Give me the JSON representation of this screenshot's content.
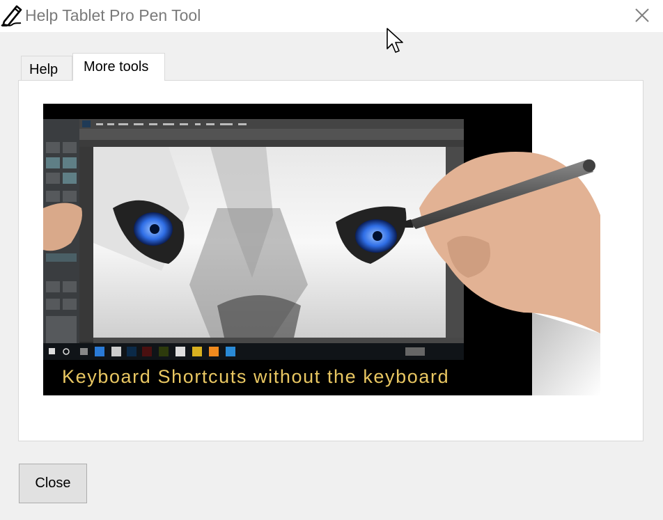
{
  "window": {
    "title": "Help Tablet Pro Pen Tool",
    "app_icon": "pen-icon",
    "close_icon": "close-icon"
  },
  "tabs": [
    {
      "label": "Help",
      "active": false
    },
    {
      "label": "More tools",
      "active": true
    }
  ],
  "content": {
    "image_caption": "Keyboard Shortcuts without the keyboard",
    "caption_color": "#e9c762"
  },
  "footer": {
    "close_label": "Close"
  },
  "colors": {
    "window_bg": "#f0f0f0",
    "panel_bg": "#ffffff",
    "title_text": "#7a7a7a"
  }
}
